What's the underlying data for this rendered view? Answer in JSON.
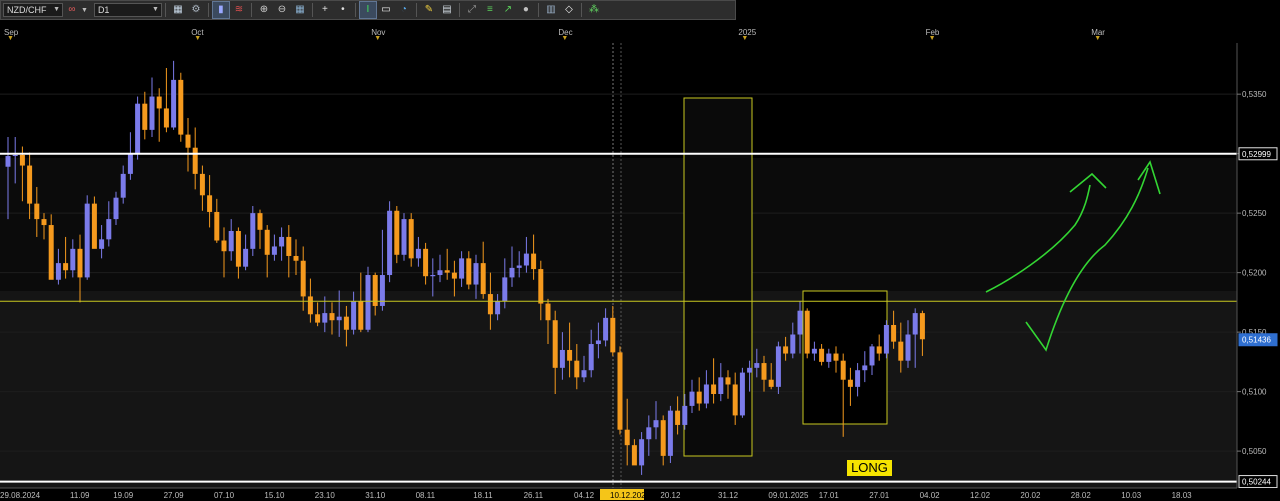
{
  "toolbar": {
    "symbol": "NZD/CHF",
    "timeframe": "D1",
    "buttons": [
      {
        "name": "new-chart-icon",
        "glyph": "▦",
        "color": "#c8d8e8"
      },
      {
        "name": "chart-settings-icon",
        "glyph": "⚙",
        "color": "#aab4c0"
      },
      {
        "name": "candle-chart-icon",
        "glyph": "▮",
        "color": "#9aa8ff",
        "active": true
      },
      {
        "name": "indicator-icon",
        "glyph": "≋",
        "color": "#e05050"
      },
      {
        "name": "zoom-in-icon",
        "glyph": "⊕",
        "color": "#d0d0d0"
      },
      {
        "name": "zoom-out-icon",
        "glyph": "⊖",
        "color": "#d0d0d0"
      },
      {
        "name": "grid-icon",
        "glyph": "▦",
        "color": "#8ab0d0"
      },
      {
        "name": "crosshair-icon",
        "glyph": "+",
        "color": "#e0e0e0"
      },
      {
        "name": "dot-icon",
        "glyph": "•",
        "color": "#e0e0e0"
      },
      {
        "name": "text-cursor-icon",
        "glyph": "I",
        "color": "#3fe05a",
        "active": true
      },
      {
        "name": "comment-icon",
        "glyph": "▭",
        "color": "#f0f0f0"
      },
      {
        "name": "objects-icon",
        "glyph": "◔",
        "color": "#58a8e8"
      },
      {
        "name": "pencil-icon",
        "glyph": "✎",
        "color": "#f0d040"
      },
      {
        "name": "template-icon",
        "glyph": "▤",
        "color": "#d0d8e0"
      },
      {
        "name": "fibonacci-icon",
        "glyph": "⤢",
        "color": "#9a9a9a"
      },
      {
        "name": "channel-icon",
        "glyph": "≡",
        "color": "#5ad05a"
      },
      {
        "name": "arrow-line-icon",
        "glyph": "↗",
        "color": "#5ad05a"
      },
      {
        "name": "shape-icon",
        "glyph": "●",
        "color": "#c0c0c0"
      },
      {
        "name": "grid-lines-icon",
        "glyph": "▥",
        "color": "#9ab0c8"
      },
      {
        "name": "eraser-icon",
        "glyph": "◇",
        "color": "#f0f0f0"
      },
      {
        "name": "more-icon",
        "glyph": "⁂",
        "color": "#60d060"
      }
    ]
  },
  "month_axis": {
    "labels": [
      "Sep",
      "Oct",
      "Nov",
      "Dec",
      "2025",
      "Feb",
      "Mar"
    ]
  },
  "date_axis": {
    "labels": [
      "29.08.2024",
      "11.09",
      "19.09",
      "27.09",
      "07.10",
      "15.10",
      "23.10",
      "31.10",
      "08.11",
      "18.11",
      "26.11",
      "04.12",
      "10.12.2024",
      "20.12",
      "31.12",
      "09.01.2025",
      "17.01",
      "27.01",
      "04.02",
      "12.02",
      "20.02",
      "28.02",
      "10.03",
      "18.03"
    ],
    "highlight": "10.12.2024"
  },
  "price_axis": {
    "ticks": [
      "0,5350",
      "0,5300",
      "0,5250",
      "0,5200",
      "0,5150",
      "0,5100",
      "0,5050"
    ],
    "markers": [
      {
        "label": "0,52999",
        "value": 0.52999,
        "style": "white"
      },
      {
        "label": "0,51436",
        "value": 0.51436,
        "style": "blue"
      },
      {
        "label": "0,50244",
        "value": 0.50244,
        "style": "white"
      }
    ]
  },
  "annotations": {
    "long_label": "LONG"
  },
  "colors": {
    "bull": "#7b7bea",
    "bear": "#f59a1e",
    "yellow": "#c8c820",
    "green": "#33d633",
    "white": "#ffffff",
    "blue_marker": "#2f6fd0"
  },
  "chart_data": {
    "type": "candlestick",
    "symbol": "NZD/CHF",
    "timeframe": "D1",
    "ylim": [
      0.5019,
      0.5393
    ],
    "levels": [
      0.52999,
      0.5176,
      0.50244
    ],
    "candles": [
      [
        0.5289,
        0.5314,
        0.5245,
        0.5298
      ],
      [
        0.5298,
        0.5314,
        0.5275,
        0.5299
      ],
      [
        0.5299,
        0.5306,
        0.526,
        0.529
      ],
      [
        0.529,
        0.5301,
        0.5245,
        0.5258
      ],
      [
        0.5258,
        0.5272,
        0.523,
        0.5245
      ],
      [
        0.5245,
        0.525,
        0.5228,
        0.524
      ],
      [
        0.524,
        0.5249,
        0.5202,
        0.5194
      ],
      [
        0.5194,
        0.522,
        0.519,
        0.5208
      ],
      [
        0.5208,
        0.523,
        0.5195,
        0.5202
      ],
      [
        0.5202,
        0.5228,
        0.5196,
        0.522
      ],
      [
        0.522,
        0.5232,
        0.5175,
        0.5196
      ],
      [
        0.5196,
        0.5265,
        0.5194,
        0.5258
      ],
      [
        0.5258,
        0.5264,
        0.5222,
        0.522
      ],
      [
        0.522,
        0.524,
        0.5212,
        0.5228
      ],
      [
        0.5228,
        0.526,
        0.5222,
        0.5245
      ],
      [
        0.5245,
        0.5268,
        0.524,
        0.5263
      ],
      [
        0.5263,
        0.529,
        0.5258,
        0.5283
      ],
      [
        0.5283,
        0.5318,
        0.5278,
        0.53
      ],
      [
        0.53,
        0.5348,
        0.5295,
        0.5342
      ],
      [
        0.5342,
        0.5352,
        0.5312,
        0.532
      ],
      [
        0.532,
        0.5364,
        0.5314,
        0.5348
      ],
      [
        0.5348,
        0.5355,
        0.531,
        0.5338
      ],
      [
        0.5338,
        0.5372,
        0.5318,
        0.5322
      ],
      [
        0.5322,
        0.5378,
        0.532,
        0.5362
      ],
      [
        0.5362,
        0.5368,
        0.531,
        0.5316
      ],
      [
        0.5316,
        0.533,
        0.5285,
        0.5305
      ],
      [
        0.5305,
        0.5322,
        0.527,
        0.5283
      ],
      [
        0.5283,
        0.529,
        0.5252,
        0.5265
      ],
      [
        0.5265,
        0.5282,
        0.5238,
        0.5251
      ],
      [
        0.5251,
        0.5262,
        0.5225,
        0.5227
      ],
      [
        0.5227,
        0.5238,
        0.5196,
        0.5218
      ],
      [
        0.5218,
        0.5245,
        0.521,
        0.5235
      ],
      [
        0.5235,
        0.5238,
        0.5195,
        0.5205
      ],
      [
        0.5205,
        0.5232,
        0.5202,
        0.522
      ],
      [
        0.522,
        0.5256,
        0.5214,
        0.525
      ],
      [
        0.525,
        0.5253,
        0.522,
        0.5236
      ],
      [
        0.5236,
        0.524,
        0.5196,
        0.5215
      ],
      [
        0.5215,
        0.5232,
        0.521,
        0.5222
      ],
      [
        0.5222,
        0.5238,
        0.521,
        0.523
      ],
      [
        0.523,
        0.524,
        0.5196,
        0.5214
      ],
      [
        0.5214,
        0.5228,
        0.5198,
        0.521
      ],
      [
        0.521,
        0.5222,
        0.5168,
        0.518
      ],
      [
        0.518,
        0.5195,
        0.5158,
        0.5165
      ],
      [
        0.5165,
        0.5175,
        0.5155,
        0.5158
      ],
      [
        0.5158,
        0.518,
        0.515,
        0.5166
      ],
      [
        0.5166,
        0.5175,
        0.5148,
        0.516
      ],
      [
        0.516,
        0.5185,
        0.5146,
        0.5163
      ],
      [
        0.5163,
        0.5172,
        0.5138,
        0.5152
      ],
      [
        0.5152,
        0.5184,
        0.5148,
        0.5176
      ],
      [
        0.5176,
        0.52,
        0.515,
        0.5152
      ],
      [
        0.5152,
        0.5205,
        0.515,
        0.5198
      ],
      [
        0.5198,
        0.52,
        0.5164,
        0.5172
      ],
      [
        0.5172,
        0.5236,
        0.5168,
        0.5198
      ],
      [
        0.5198,
        0.526,
        0.5192,
        0.5252
      ],
      [
        0.5252,
        0.5256,
        0.5208,
        0.5215
      ],
      [
        0.5215,
        0.525,
        0.521,
        0.5245
      ],
      [
        0.5245,
        0.525,
        0.5205,
        0.5212
      ],
      [
        0.5212,
        0.523,
        0.5205,
        0.522
      ],
      [
        0.522,
        0.5225,
        0.519,
        0.5197
      ],
      [
        0.5197,
        0.5212,
        0.518,
        0.5198
      ],
      [
        0.5198,
        0.5215,
        0.5192,
        0.5202
      ],
      [
        0.5202,
        0.522,
        0.5194,
        0.52
      ],
      [
        0.52,
        0.521,
        0.518,
        0.5195
      ],
      [
        0.5195,
        0.5218,
        0.5188,
        0.5212
      ],
      [
        0.5212,
        0.5218,
        0.5186,
        0.519
      ],
      [
        0.519,
        0.5215,
        0.5178,
        0.5208
      ],
      [
        0.5208,
        0.5226,
        0.5178,
        0.5182
      ],
      [
        0.5182,
        0.52,
        0.5152,
        0.5165
      ],
      [
        0.5165,
        0.5182,
        0.516,
        0.5176
      ],
      [
        0.5176,
        0.5212,
        0.517,
        0.5196
      ],
      [
        0.5196,
        0.5222,
        0.5188,
        0.5204
      ],
      [
        0.5204,
        0.5218,
        0.5196,
        0.5206
      ],
      [
        0.5206,
        0.523,
        0.52,
        0.5216
      ],
      [
        0.5216,
        0.5232,
        0.5194,
        0.5203
      ],
      [
        0.5203,
        0.521,
        0.516,
        0.5174
      ],
      [
        0.5174,
        0.5178,
        0.514,
        0.516
      ],
      [
        0.516,
        0.5168,
        0.5098,
        0.512
      ],
      [
        0.512,
        0.515,
        0.511,
        0.5135
      ],
      [
        0.5135,
        0.5158,
        0.5112,
        0.5126
      ],
      [
        0.5126,
        0.514,
        0.5102,
        0.5112
      ],
      [
        0.5112,
        0.513,
        0.5108,
        0.5118
      ],
      [
        0.5118,
        0.5152,
        0.5112,
        0.514
      ],
      [
        0.514,
        0.5158,
        0.5128,
        0.5143
      ],
      [
        0.5143,
        0.517,
        0.5138,
        0.5162
      ],
      [
        0.5162,
        0.5172,
        0.513,
        0.5133
      ],
      [
        0.5133,
        0.5138,
        0.5064,
        0.5068
      ],
      [
        0.5068,
        0.5094,
        0.5038,
        0.5055
      ],
      [
        0.5055,
        0.506,
        0.5042,
        0.5038
      ],
      [
        0.5038,
        0.5066,
        0.503,
        0.506
      ],
      [
        0.506,
        0.508,
        0.5046,
        0.507
      ],
      [
        0.507,
        0.5092,
        0.506,
        0.5076
      ],
      [
        0.5076,
        0.508,
        0.5038,
        0.5046
      ],
      [
        0.5046,
        0.5088,
        0.504,
        0.5084
      ],
      [
        0.5084,
        0.5096,
        0.5064,
        0.5072
      ],
      [
        0.5072,
        0.5098,
        0.5068,
        0.5088
      ],
      [
        0.5088,
        0.511,
        0.5082,
        0.51
      ],
      [
        0.51,
        0.5112,
        0.5084,
        0.509
      ],
      [
        0.509,
        0.5118,
        0.5086,
        0.5106
      ],
      [
        0.5106,
        0.5128,
        0.509,
        0.5098
      ],
      [
        0.5098,
        0.5124,
        0.5092,
        0.5112
      ],
      [
        0.5112,
        0.5118,
        0.5094,
        0.5106
      ],
      [
        0.5106,
        0.5116,
        0.5072,
        0.508
      ],
      [
        0.508,
        0.512,
        0.5078,
        0.5116
      ],
      [
        0.5116,
        0.5126,
        0.51,
        0.512
      ],
      [
        0.512,
        0.5136,
        0.5112,
        0.5124
      ],
      [
        0.5124,
        0.513,
        0.51,
        0.511
      ],
      [
        0.511,
        0.5124,
        0.5102,
        0.5104
      ],
      [
        0.5104,
        0.5142,
        0.5098,
        0.5138
      ],
      [
        0.5138,
        0.5146,
        0.5126,
        0.5132
      ],
      [
        0.5132,
        0.5158,
        0.5128,
        0.5148
      ],
      [
        0.5148,
        0.5176,
        0.5132,
        0.5168
      ],
      [
        0.5168,
        0.517,
        0.5128,
        0.5132
      ],
      [
        0.5132,
        0.5142,
        0.5126,
        0.5136
      ],
      [
        0.5136,
        0.514,
        0.5122,
        0.5125
      ],
      [
        0.5125,
        0.5136,
        0.512,
        0.5132
      ],
      [
        0.5132,
        0.5138,
        0.5116,
        0.5126
      ],
      [
        0.5126,
        0.5132,
        0.5062,
        0.511
      ],
      [
        0.511,
        0.512,
        0.5088,
        0.5104
      ],
      [
        0.5104,
        0.5124,
        0.5096,
        0.5118
      ],
      [
        0.5118,
        0.5134,
        0.5108,
        0.5122
      ],
      [
        0.5122,
        0.514,
        0.5114,
        0.5138
      ],
      [
        0.5138,
        0.5148,
        0.5126,
        0.5132
      ],
      [
        0.5132,
        0.516,
        0.5128,
        0.5156
      ],
      [
        0.5156,
        0.5168,
        0.5136,
        0.5142
      ],
      [
        0.5142,
        0.5158,
        0.5116,
        0.5126
      ],
      [
        0.5126,
        0.516,
        0.512,
        0.5148
      ],
      [
        0.5148,
        0.517,
        0.512,
        0.5166
      ],
      [
        0.5166,
        0.5168,
        0.513,
        0.5144
      ]
    ]
  }
}
